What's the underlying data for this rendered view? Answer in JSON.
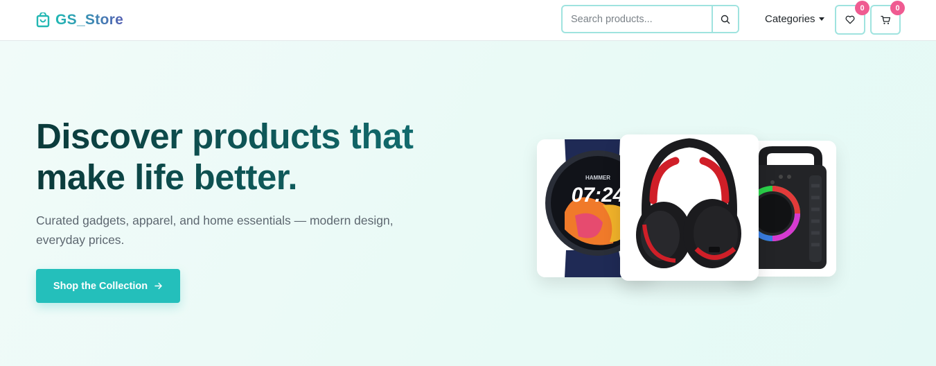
{
  "brand": {
    "name": "GS_Store",
    "icon": "shopping-bag-icon"
  },
  "search": {
    "placeholder": "Search products...",
    "value": "",
    "icon": "search-icon"
  },
  "nav": {
    "categories_label": "Categories",
    "wishlist": {
      "icon": "heart-icon",
      "count": "0"
    },
    "cart": {
      "icon": "cart-icon",
      "count": "0"
    }
  },
  "hero": {
    "headline": "Discover products that make life better.",
    "subtext": "Curated gadgets, apparel, and home essentials — modern design, everyday prices.",
    "cta_label": "Shop the Collection",
    "cta_icon": "arrow-right-icon"
  },
  "products": {
    "watch": {
      "brand_text": "HAMMER",
      "time": "07:24"
    },
    "headphones": {},
    "speaker": {}
  },
  "colors": {
    "accent": "#24bfbb",
    "badge": "#ef5b91",
    "headline": "#0f5b5c",
    "hero_bg": "#e9faf6"
  }
}
